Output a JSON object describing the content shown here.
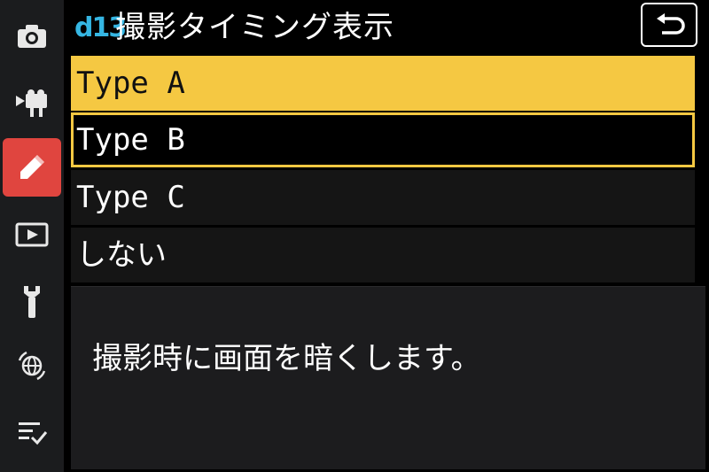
{
  "sidebar": {
    "items": [
      {
        "icon": "camera-icon",
        "active": false
      },
      {
        "icon": "movie-camera-icon",
        "active": false
      },
      {
        "icon": "pencil-icon",
        "active": true
      },
      {
        "icon": "playback-icon",
        "active": false
      },
      {
        "icon": "wrench-icon",
        "active": false
      },
      {
        "icon": "network-icon",
        "active": false
      },
      {
        "icon": "my-menu-icon",
        "active": false
      }
    ]
  },
  "header": {
    "code": "d13",
    "title": "撮影タイミング表示",
    "back_icon": "back-arrow-icon"
  },
  "options": [
    {
      "label": "Type A",
      "state": "highlighted"
    },
    {
      "label": "Type B",
      "state": "selected"
    },
    {
      "label": "Type C",
      "state": "normal"
    },
    {
      "label": "しない",
      "state": "normal"
    }
  ],
  "description": {
    "text": "撮影時に画面を暗くします。"
  },
  "colors": {
    "highlight": "#f5c842",
    "active_tab": "#e0453f",
    "code_badge": "#35b6e3"
  }
}
